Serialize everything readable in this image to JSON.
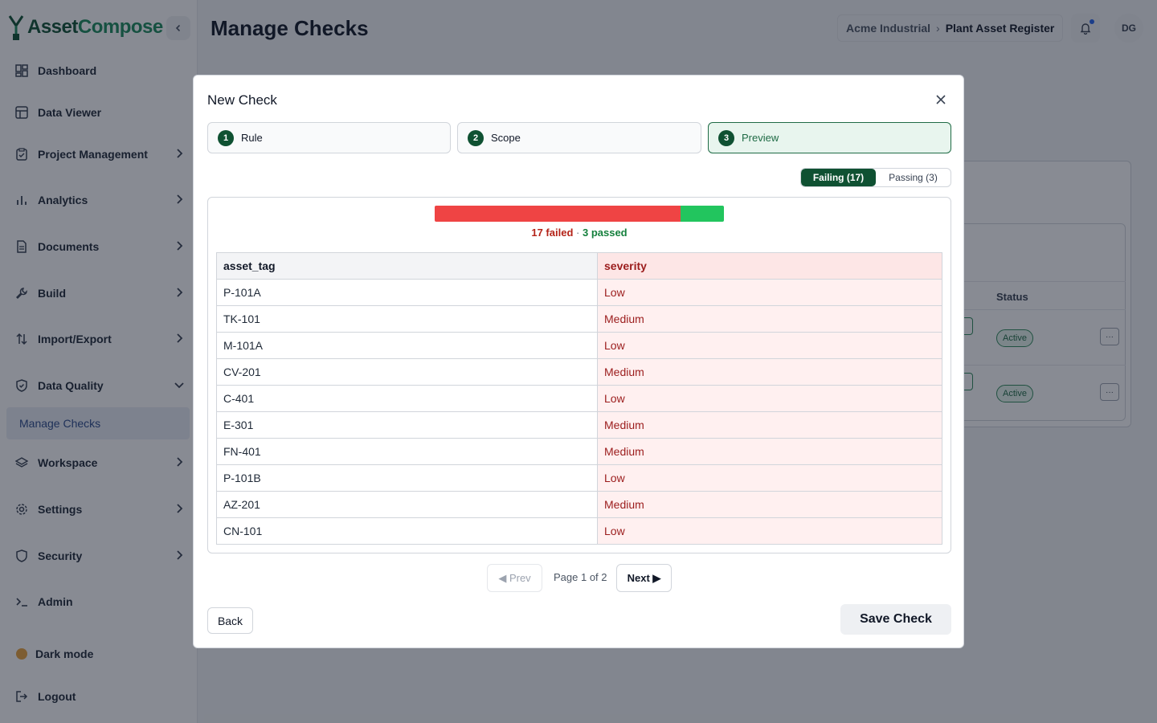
{
  "app": {
    "brand_part1": "Asset",
    "brand_part2": "Compose",
    "accent": "#0f5132"
  },
  "sidebar": {
    "items": [
      {
        "label": "Dashboard",
        "icon": "dashboard-icon"
      },
      {
        "label": "Data Viewer",
        "icon": "table-icon"
      },
      {
        "label": "Project Management",
        "icon": "clipboard-icon"
      },
      {
        "label": "Analytics",
        "icon": "bar-chart-icon"
      },
      {
        "label": "Documents",
        "icon": "document-icon"
      },
      {
        "label": "Build",
        "icon": "wrench-icon"
      },
      {
        "label": "Import/Export",
        "icon": "arrows-updown-icon"
      },
      {
        "label": "Data Quality",
        "icon": "shield-check-icon"
      },
      {
        "label": "Workspace",
        "icon": "layers-icon"
      },
      {
        "label": "Settings",
        "icon": "gear-icon"
      },
      {
        "label": "Security",
        "icon": "shield-icon"
      },
      {
        "label": "Admin",
        "icon": "terminal-icon"
      }
    ],
    "active_sub": "Manage Checks",
    "dark_mode": "Dark mode",
    "logout": "Logout"
  },
  "header": {
    "title": "Manage Checks",
    "breadcrumb_org": "Acme Industrial",
    "breadcrumb_sep": "›",
    "breadcrumb_project": "Plant Asset Register",
    "avatar": "DG"
  },
  "background": {
    "status_header": "Status",
    "row_status": [
      "Active",
      "Active"
    ],
    "more": "···"
  },
  "modal": {
    "title": "New Check",
    "steps": [
      {
        "num": "1",
        "label": "Rule"
      },
      {
        "num": "2",
        "label": "Scope"
      },
      {
        "num": "3",
        "label": "Preview"
      }
    ],
    "toggle_failing": "Failing (17)",
    "toggle_passing": "Passing (3)",
    "failed": 17,
    "passed": 3,
    "caption_failed": "17 failed",
    "caption_sep": "·",
    "caption_passed": "3 passed",
    "columns": [
      "asset_tag",
      "severity"
    ],
    "rows": [
      [
        "P-101A",
        "Low"
      ],
      [
        "TK-101",
        "Medium"
      ],
      [
        "M-101A",
        "Low"
      ],
      [
        "CV-201",
        "Medium"
      ],
      [
        "C-401",
        "Low"
      ],
      [
        "E-301",
        "Medium"
      ],
      [
        "FN-401",
        "Medium"
      ],
      [
        "P-101B",
        "Low"
      ],
      [
        "AZ-201",
        "Medium"
      ],
      [
        "CN-101",
        "Low"
      ]
    ],
    "prev": "◀ Prev",
    "page_info": "Page 1 of 2",
    "next": "Next ▶",
    "back": "Back",
    "save": "Save Check"
  }
}
